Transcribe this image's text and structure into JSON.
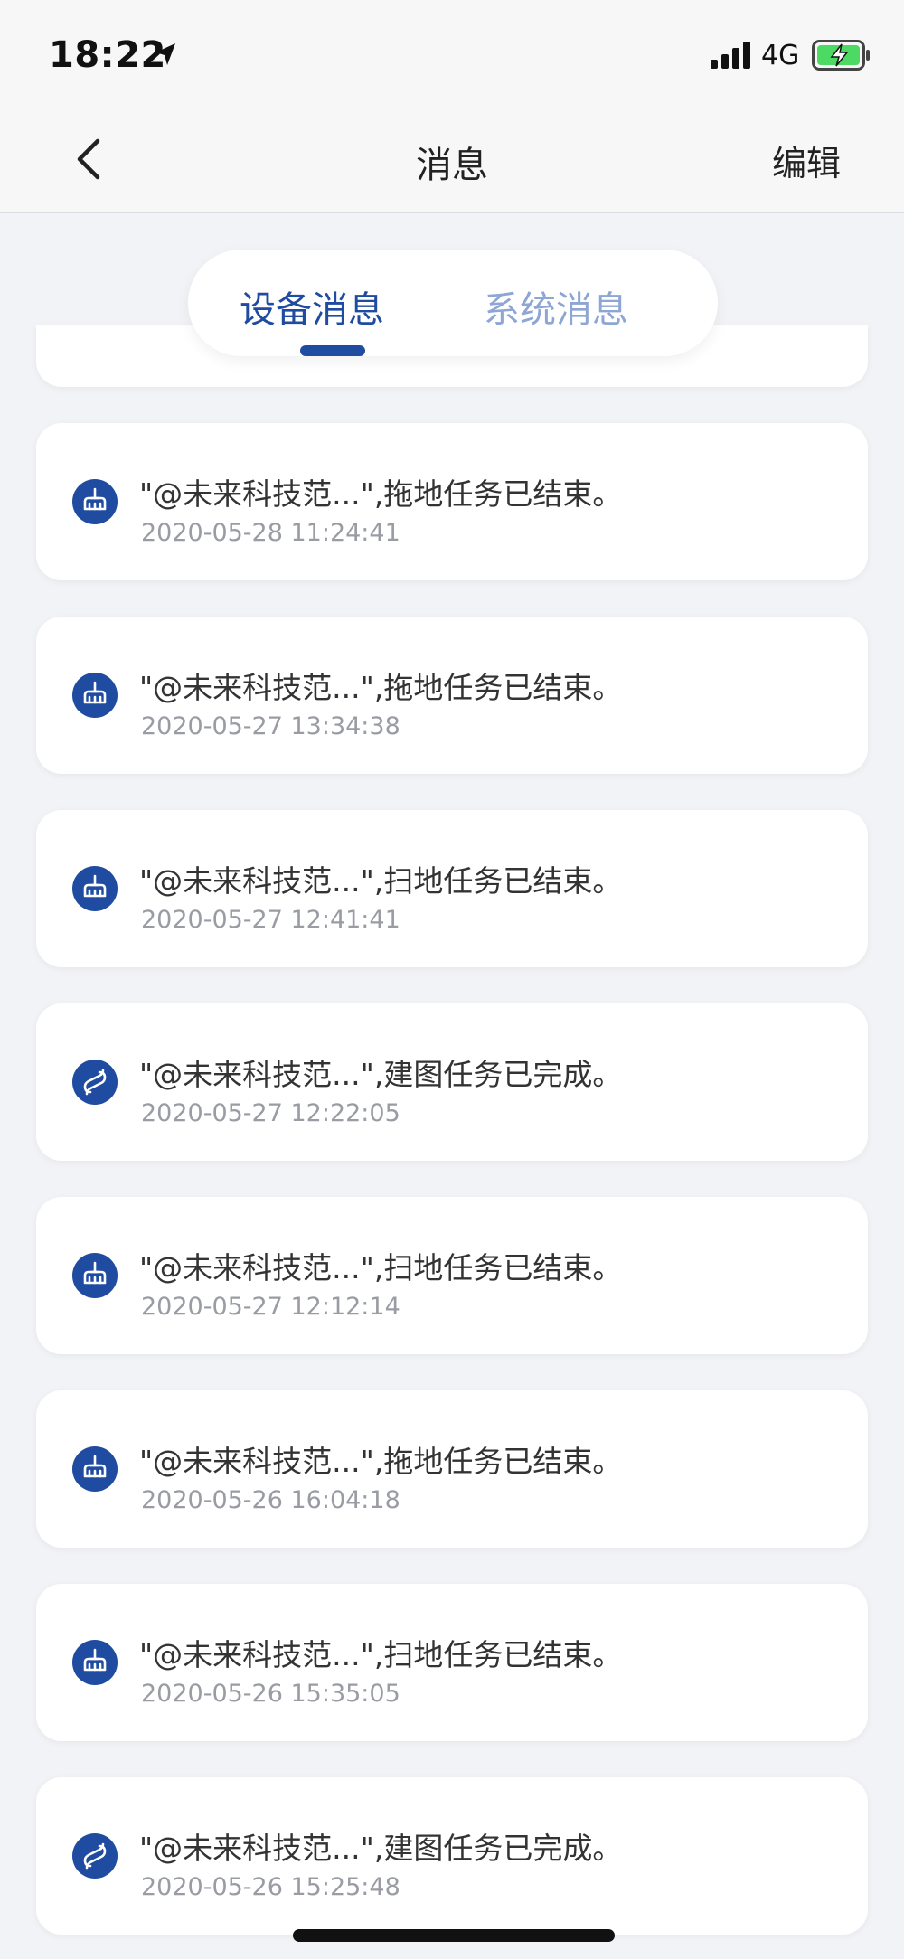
{
  "status_bar": {
    "time": "18:22",
    "network": "4G"
  },
  "nav": {
    "title": "消息",
    "edit_label": "编辑"
  },
  "tabs": [
    {
      "label": "设备消息",
      "active": true
    },
    {
      "label": "系统消息",
      "active": false
    }
  ],
  "colors": {
    "accent": "#1f4ba0",
    "tab_inactive": "#8ea6d4",
    "background": "#f2f3f7"
  },
  "messages": [
    {
      "icon": "mop-icon",
      "text": "\"@未来科技范...\",拖地任务已结束。",
      "time": "2020-05-28 11:24:41"
    },
    {
      "icon": "mop-icon",
      "text": "\"@未来科技范...\",拖地任务已结束。",
      "time": "2020-05-27 13:34:38"
    },
    {
      "icon": "mop-icon",
      "text": "\"@未来科技范...\",扫地任务已结束。",
      "time": "2020-05-27 12:41:41"
    },
    {
      "icon": "map-build-icon",
      "text": "\"@未来科技范...\",建图任务已完成。",
      "time": "2020-05-27 12:22:05"
    },
    {
      "icon": "mop-icon",
      "text": "\"@未来科技范...\",扫地任务已结束。",
      "time": "2020-05-27 12:12:14"
    },
    {
      "icon": "mop-icon",
      "text": "\"@未来科技范...\",拖地任务已结束。",
      "time": "2020-05-26 16:04:18"
    },
    {
      "icon": "mop-icon",
      "text": "\"@未来科技范...\",扫地任务已结束。",
      "time": "2020-05-26 15:35:05"
    },
    {
      "icon": "map-build-icon",
      "text": "\"@未来科技范...\",建图任务已完成。",
      "time": "2020-05-26 15:25:48"
    }
  ]
}
